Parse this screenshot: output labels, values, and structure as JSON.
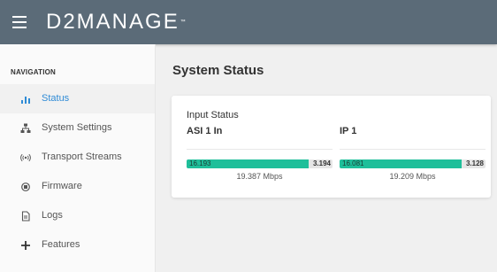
{
  "header": {
    "logo_text": "D2MANAGE",
    "logo_tm": "™",
    "menu_icon": "hamburger-icon",
    "colors": {
      "background": "#5b6b78",
      "text": "#ffffff"
    }
  },
  "sidebar": {
    "heading": "NAVIGATION",
    "items": [
      {
        "label": "Status",
        "icon": "bar-chart-icon",
        "active": true
      },
      {
        "label": "System Settings",
        "icon": "network-icon",
        "active": false
      },
      {
        "label": "Transport Streams",
        "icon": "broadcast-icon",
        "active": false
      },
      {
        "label": "Firmware",
        "icon": "chip-icon",
        "active": false
      },
      {
        "label": "Logs",
        "icon": "document-icon",
        "active": false
      },
      {
        "label": "Features",
        "icon": "plus-icon",
        "active": false
      }
    ],
    "colors": {
      "active": "#2f8bd6",
      "text": "#555555"
    }
  },
  "main": {
    "title": "System Status",
    "card": {
      "title": "Input Status",
      "columns": [
        {
          "title": "ASI 1 In",
          "bar_left": "16.193",
          "bar_right": "3.194",
          "fill_fraction": 0.835,
          "rate": "19.387 Mbps"
        },
        {
          "title": "IP 1",
          "bar_left": "16.081",
          "bar_right": "3.128",
          "fill_fraction": 0.837,
          "rate": "19.209 Mbps"
        }
      ]
    },
    "colors": {
      "bar_fill": "#1fbf9a",
      "bar_track": "#e6e6e6"
    }
  }
}
